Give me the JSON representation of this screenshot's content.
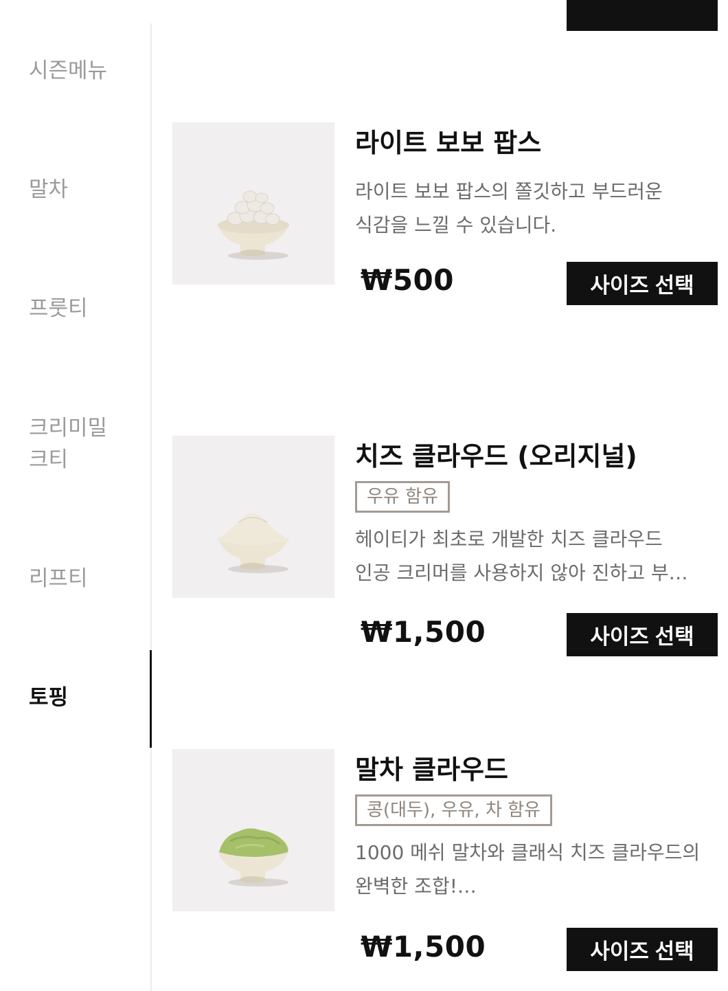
{
  "sidebar": {
    "items": [
      {
        "label": "시즌메뉴",
        "active": false
      },
      {
        "label": "말차",
        "active": false
      },
      {
        "label": "프룻티",
        "active": false
      },
      {
        "label": "크리미밀\n크티",
        "active": false
      },
      {
        "label": "리프티",
        "active": false
      },
      {
        "label": "토핑",
        "active": true
      }
    ]
  },
  "products": [
    {
      "name": "라이트 보보 팝스",
      "badge": "",
      "desc_lines": [
        "라이트 보보 팝스의 쫄깃하고 부드러운",
        "식감을 느낄 수 있습니다."
      ],
      "price": "₩500",
      "button": "사이즈 선택",
      "image": "light-bobo-pops-image"
    },
    {
      "name": "치즈 클라우드 (오리지널)",
      "badge": "우유 함유",
      "desc_lines": [
        "헤이티가 최초로 개발한 치즈 클라우드",
        "인공 크리머를 사용하지 않아 진하고 부…"
      ],
      "price": "₩1,500",
      "button": "사이즈 선택",
      "image": "cheese-cloud-image"
    },
    {
      "name": "말차 클라우드",
      "badge": "콩(대두), 우유, 차 함유",
      "desc_lines": [
        "1000 메쉬 말차와 클래식 치즈 클라우드의",
        "완벽한 조합!…"
      ],
      "price": "₩1,500",
      "button": "사이즈 선택",
      "image": "matcha-cloud-image"
    }
  ],
  "colors": {
    "accent": "#111111",
    "muted_text": "#9a9a9a",
    "badge_border": "#a39a93",
    "thumb_bg": "#f1eff0",
    "matcha": "#a6c06a",
    "cheese": "#ede6d4"
  }
}
